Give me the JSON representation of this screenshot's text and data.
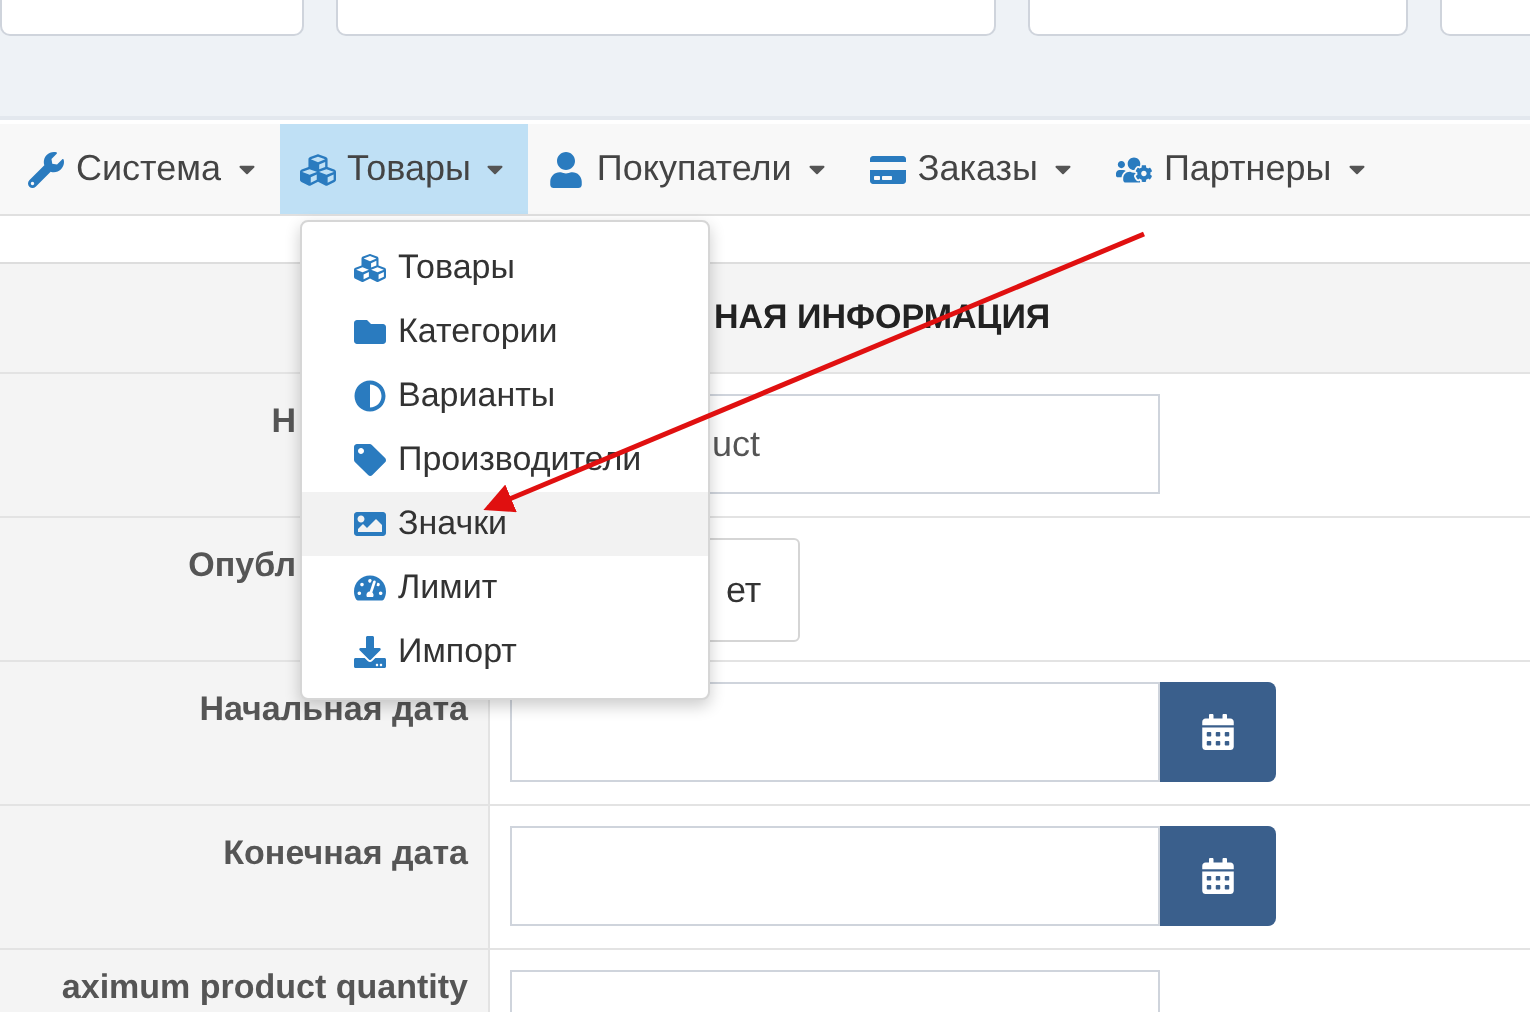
{
  "nav": [
    {
      "label": "Система",
      "selected": false
    },
    {
      "label": "Товары",
      "selected": true
    },
    {
      "label": "Покупатели",
      "selected": false
    },
    {
      "label": "Заказы",
      "selected": false
    },
    {
      "label": "Партнеры",
      "selected": false
    }
  ],
  "dropdown": [
    {
      "label": "Товары",
      "selected": false
    },
    {
      "label": "Категории",
      "selected": false
    },
    {
      "label": "Варианты",
      "selected": false
    },
    {
      "label": "Производители",
      "selected": false
    },
    {
      "label": "Значки",
      "selected": true
    },
    {
      "label": "Лимит",
      "selected": false
    },
    {
      "label": "Импорт",
      "selected": false
    }
  ],
  "form": {
    "header": "НАЯ ИНФОРМАЦИЯ",
    "rows": [
      {
        "kind": "text",
        "label": "Н",
        "value": "uct"
      },
      {
        "kind": "toggle",
        "label": "Опубл",
        "value": "ет"
      },
      {
        "kind": "date",
        "label": "Начальная дата"
      },
      {
        "kind": "date",
        "label": "Конечная дата"
      },
      {
        "kind": "text",
        "label": "aximum product quantity",
        "value": ""
      }
    ]
  }
}
